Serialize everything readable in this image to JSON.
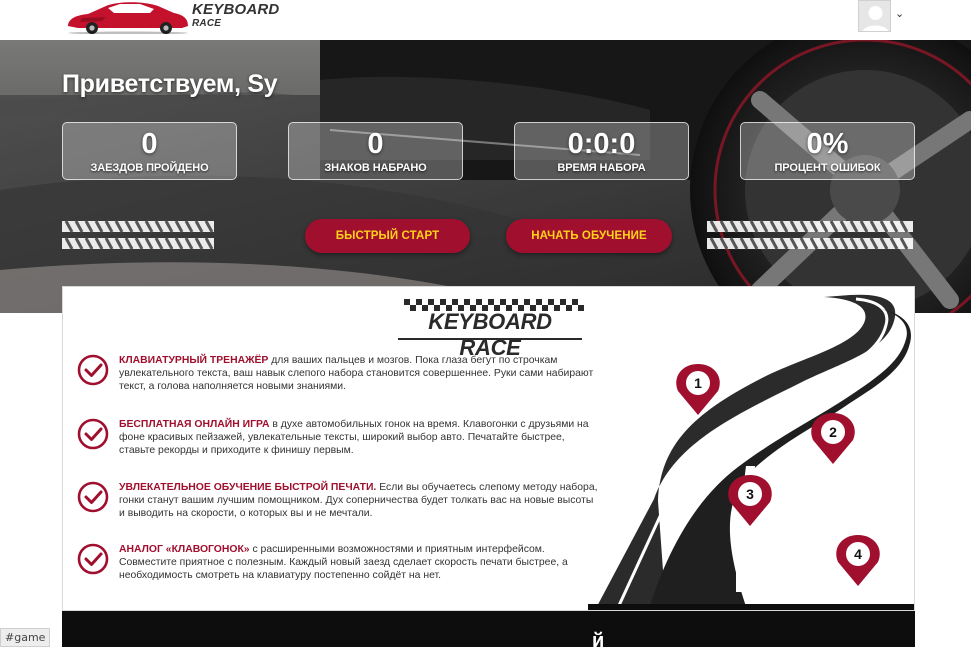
{
  "header": {
    "logo_title": "KEYBOARD",
    "logo_subtitle": "RACE"
  },
  "hero": {
    "greeting": "Приветствуем, Sy",
    "stats": [
      {
        "value": "0",
        "label": "ЗАЕЗДОВ ПРОЙДЕНО"
      },
      {
        "value": "0",
        "label": "ЗНАКОВ НАБРАНО"
      },
      {
        "value": "0:0:0",
        "label": "ВРЕМЯ НАБОРА"
      },
      {
        "value": "0%",
        "label": "ПРОЦЕНТ ОШИБОК"
      }
    ],
    "quick_start_label": "БЫСТРЫЙ СТАРТ",
    "start_learning_label": "НАЧАТЬ ОБУЧЕНИЕ"
  },
  "info": {
    "brand_title": "KEYBOARD RACE",
    "features": [
      {
        "title": "КЛАВИАТУРНЫЙ ТРЕНАЖЁР",
        "text": " для ваших пальцев и мозгов. Пока глаза бегут по строчкам увлекательного текста, ваш навык слепого набора становится совершеннее. Руки сами набирают текст, а голова наполняется новыми знаниями."
      },
      {
        "title": "БЕСПЛАТНАЯ ОНЛАЙН ИГРА",
        "text": " в духе автомобильных гонок на время. Клавогонки с друзьями на фоне красивых пейзажей, увлекательные тексты, широкий выбор авто. Печатайте быстрее, ставьте рекорды и приходите к финишу первым."
      },
      {
        "title": "УВЛЕКАТЕЛЬНОЕ ОБУЧЕНИЕ БЫСТРОЙ ПЕЧАТИ.",
        "text": " Если вы обучаетесь слепому методу набора, гонки станут вашим лучшим помощником. Дух соперничества будет толкать вас на новые высоты и выводить на скорости, о которых вы и не мечтали."
      },
      {
        "title": "АНАЛОГ «КЛАВОГОНОК»",
        "text": " с расширенными возможностями и приятным интерфейсом. Совместите приятное с полезным. Каждый новый заезд сделает скорость печати быстрее, а необходимость смотреть на клавиатуру постепенно сойдёт на нет."
      }
    ],
    "road_markers": [
      "1",
      "2",
      "3",
      "4"
    ]
  },
  "footer_glyph": "й",
  "status_tag": "#game",
  "colors": {
    "accent": "#a0102e",
    "button_text": "#ffd21a",
    "dark": "#0d0d0d"
  }
}
